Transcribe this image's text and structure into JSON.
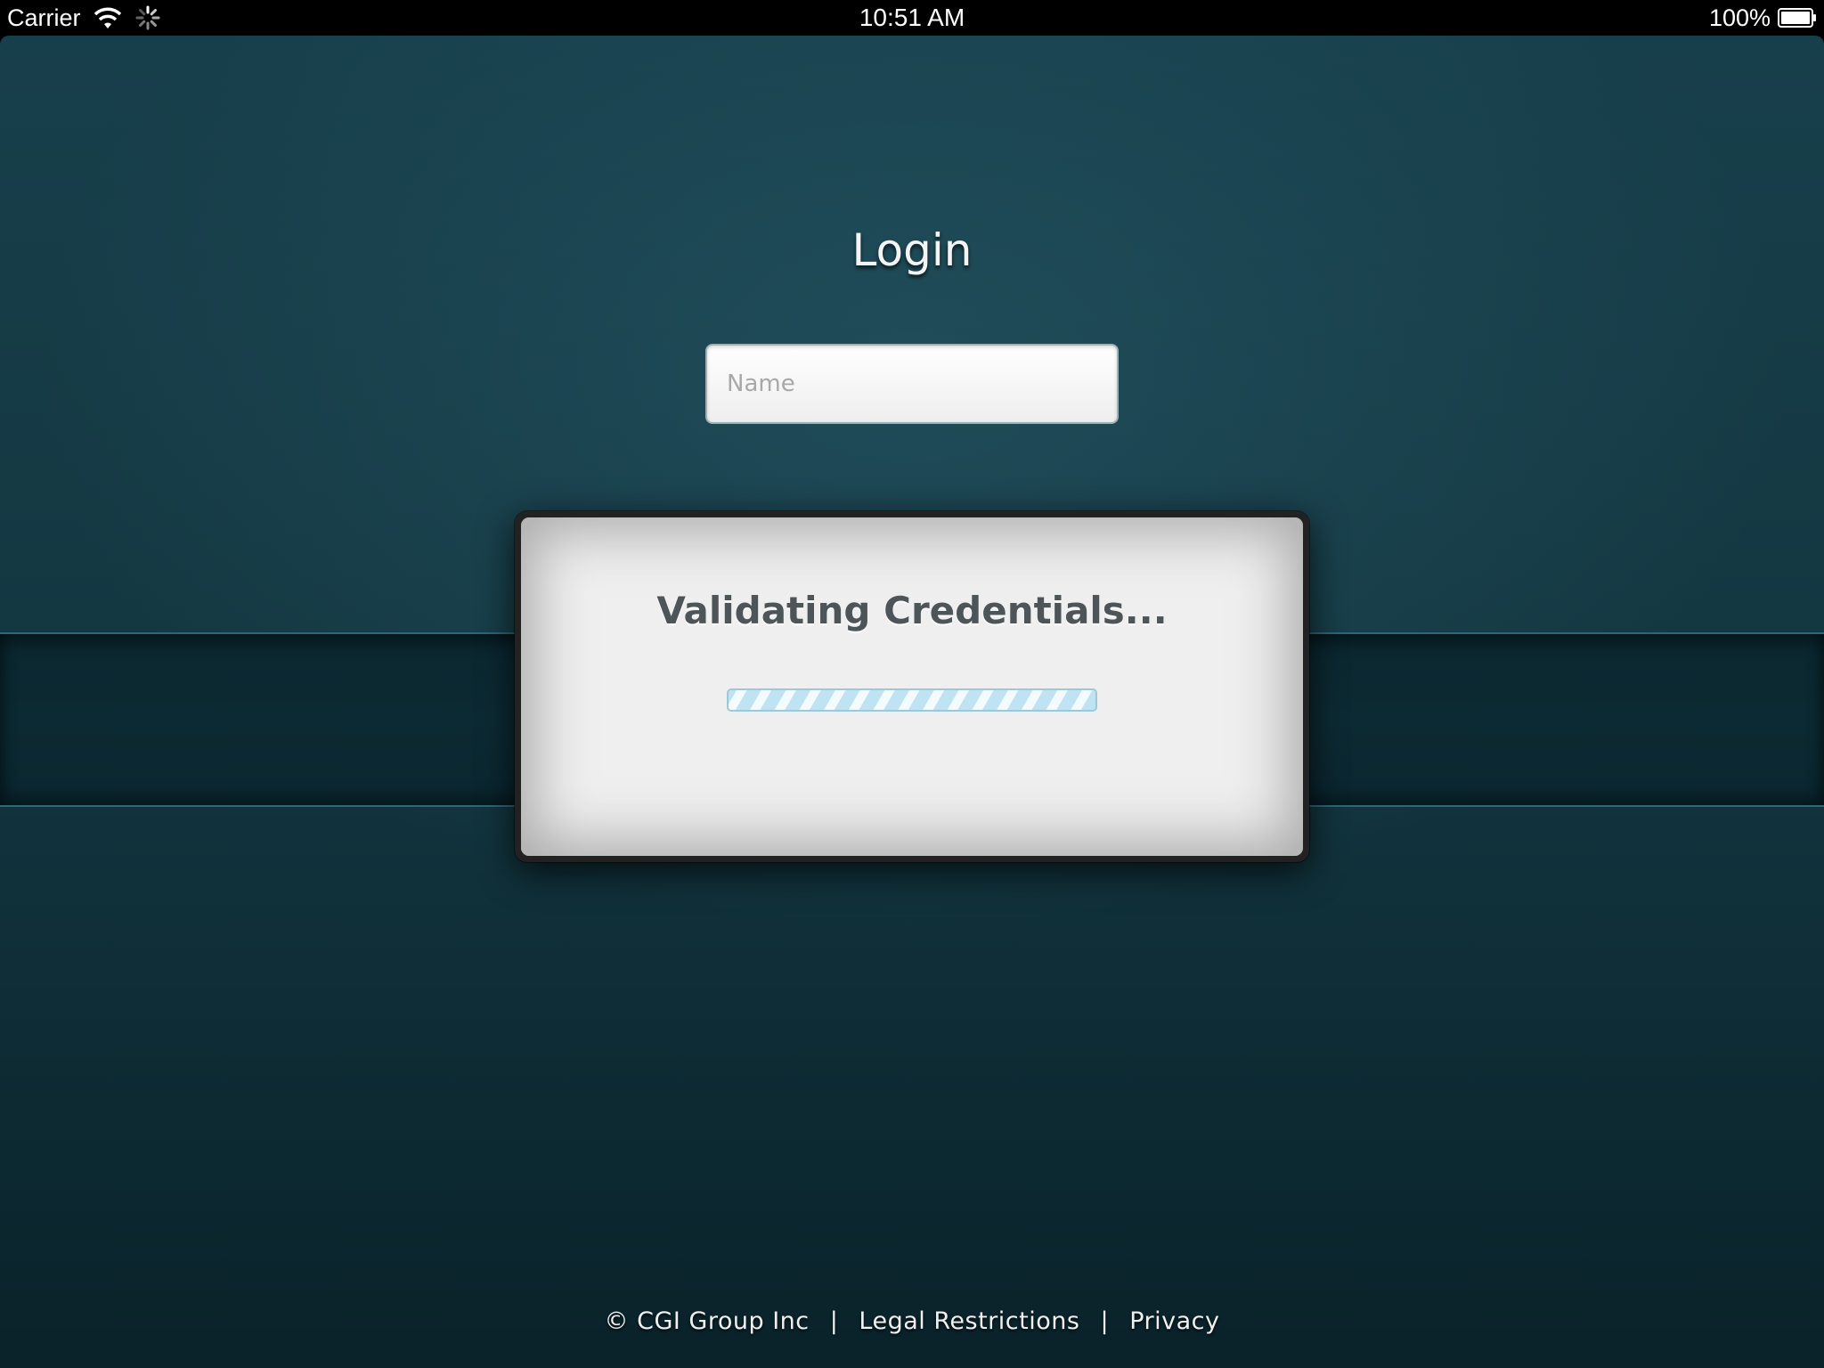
{
  "status_bar": {
    "carrier": "Carrier",
    "time": "10:51 AM",
    "battery": "100%",
    "icons": [
      "wifi-icon",
      "activity-spinner-icon",
      "battery-icon"
    ]
  },
  "login": {
    "title": "Login",
    "name_placeholder": "Name",
    "name_value": ""
  },
  "dialog": {
    "message": "Validating Credentials...",
    "progress": 1.0
  },
  "footer": {
    "copyright": "© CGI Group Inc",
    "separator": "|",
    "legal_link": "Legal Restrictions",
    "privacy_link": "Privacy"
  },
  "colors": {
    "background": "#143842",
    "band": "#0c2a33",
    "dialog": "#efefef",
    "dialog_text": "#4d5558",
    "progress": "#bfe3f2"
  }
}
